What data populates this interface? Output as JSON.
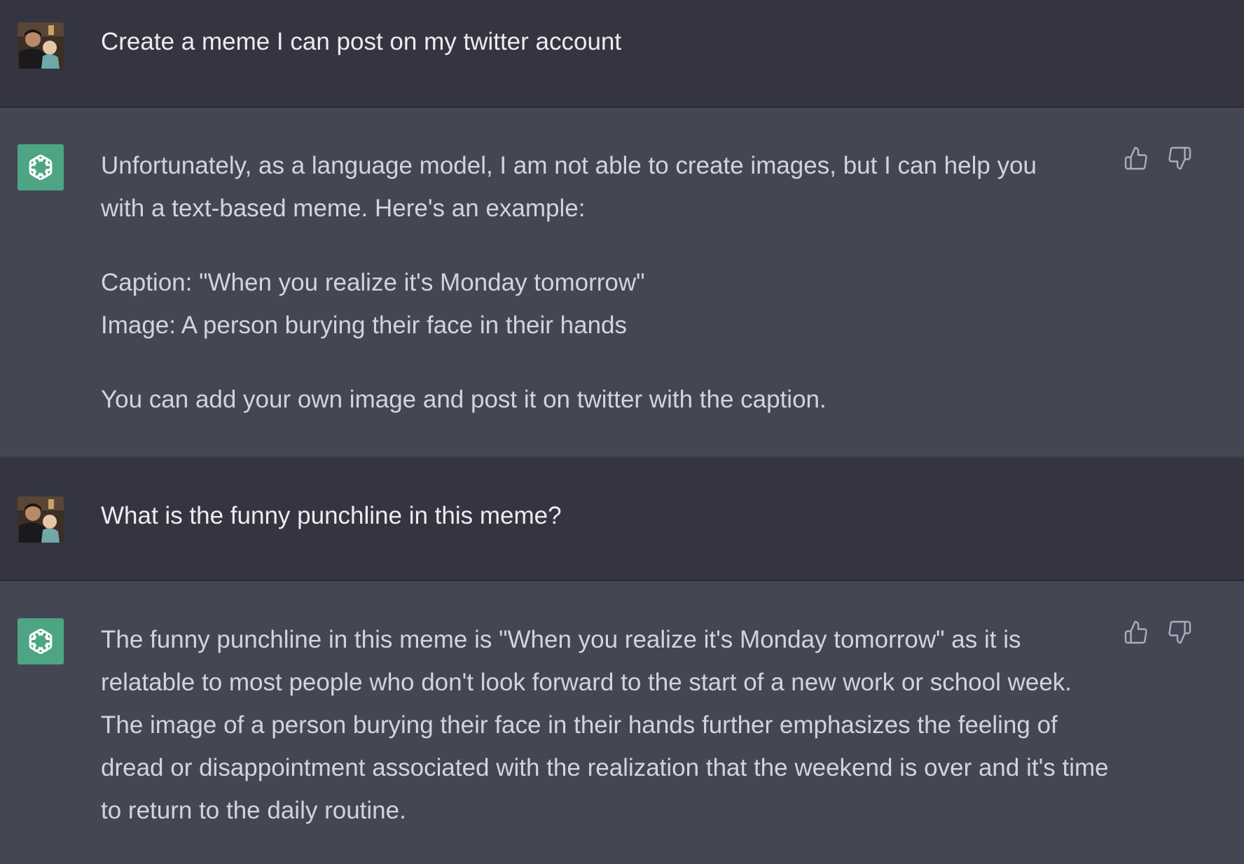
{
  "messages": [
    {
      "role": "user",
      "avatar": "user-photo",
      "text": "Create a meme I can post on my twitter account"
    },
    {
      "role": "assistant",
      "avatar": "openai-logo-icon",
      "paragraphs": [
        "Unfortunately, as a language model, I am not able to create images, but I can help you with a text-based meme. Here's an example:",
        "Caption: \"When you realize it's Monday tomorrow\"",
        "Image: A person burying their face in their hands",
        "You can add your own image and post it on twitter with the caption."
      ]
    },
    {
      "role": "user",
      "avatar": "user-photo",
      "text": "What is the funny punchline in this meme?"
    },
    {
      "role": "assistant",
      "avatar": "openai-logo-icon",
      "paragraphs": [
        "The funny punchline in this meme is \"When you realize it's Monday tomorrow\" as it is relatable to most people who don't look forward to the start of a new work or school week. The image of a person burying their face in their hands further emphasizes the feeling of dread or disappointment associated with the realization that the weekend is over and it's time to return to the daily routine."
      ]
    }
  ],
  "icons": {
    "thumbs_up": "thumbs-up-icon",
    "thumbs_down": "thumbs-down-icon"
  },
  "colors": {
    "user_bg": "#343541",
    "assistant_bg": "#444654",
    "bot_avatar": "#4da584",
    "text": "#d1d5db"
  }
}
